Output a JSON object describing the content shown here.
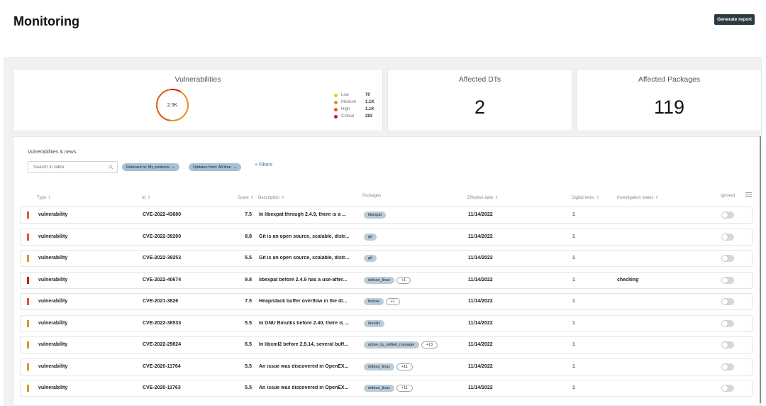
{
  "page": {
    "title": "Monitoring",
    "generate_report_label": "Generate report"
  },
  "cards": {
    "vulnerabilities": {
      "title": "Vulnerabilities",
      "total": "2.5K",
      "legend": [
        {
          "name": "Low",
          "value": "70",
          "color": "#f2c830"
        },
        {
          "name": "Medium",
          "value": "1.1K",
          "color": "#e8902a"
        },
        {
          "name": "High",
          "value": "1.1K",
          "color": "#e35b1e"
        },
        {
          "name": "Critical",
          "value": "283",
          "color": "#c81e1e"
        }
      ]
    },
    "affected_dts": {
      "title": "Affected DTs",
      "value": "2"
    },
    "affected_packages": {
      "title": "Affected Packages",
      "value": "119"
    }
  },
  "table": {
    "section_label": "Vulnerabilities & news",
    "search_placeholder": "Search in table",
    "filters": [
      {
        "label": "Relevant to: My products"
      },
      {
        "label": "Updates from: All time"
      }
    ],
    "add_filter_label": "+ Filters",
    "columns": {
      "type": "Type",
      "id": "Id",
      "score": "Score",
      "description": "Description",
      "packages": "Packages",
      "effective_date": "Effective date",
      "digital_twins": "Digital twins",
      "investigation_status": "Investigation status",
      "ignored": "Ignored"
    },
    "rows": [
      {
        "severity_color": "#e35b1e",
        "type": "vulnerability",
        "id": "CVE-2022-43680",
        "score": "7.5",
        "description": "In libexpat through 2.4.9, there is a ...",
        "packages": [
          "libexpat"
        ],
        "more": "",
        "date": "11/14/2022",
        "digital_twins": "1",
        "status": ""
      },
      {
        "severity_color": "#e35b1e",
        "type": "vulnerability",
        "id": "CVE-2022-39260",
        "score": "8.8",
        "description": "Git is an open source, scalable, distr...",
        "packages": [
          "git"
        ],
        "more": "",
        "date": "11/14/2022",
        "digital_twins": "1",
        "status": ""
      },
      {
        "severity_color": "#e8902a",
        "type": "vulnerability",
        "id": "CVE-2022-39253",
        "score": "5.5",
        "description": "Git is an open source, scalable, distr...",
        "packages": [
          "git"
        ],
        "more": "",
        "date": "11/14/2022",
        "digital_twins": "1",
        "status": ""
      },
      {
        "severity_color": "#c81e1e",
        "type": "vulnerability",
        "id": "CVE-2022-40674",
        "score": "9.8",
        "description": "libexpat before 2.4.9 has a use-after...",
        "packages": [
          "debian_linux"
        ],
        "more": "+1",
        "date": "11/14/2022",
        "digital_twins": "1",
        "status": "checking"
      },
      {
        "severity_color": "#e35b1e",
        "type": "vulnerability",
        "id": "CVE-2021-3826",
        "score": "7.5",
        "description": "Heap/stack buffer overflow in the dl...",
        "packages": [
          "fedora"
        ],
        "more": "+1",
        "date": "11/14/2022",
        "digital_twins": "1",
        "status": ""
      },
      {
        "severity_color": "#e8902a",
        "type": "vulnerability",
        "id": "CVE-2022-38533",
        "score": "5.5",
        "description": "In GNU Binutils before 2.40, there is ...",
        "packages": [
          "binutils"
        ],
        "more": "",
        "date": "11/14/2022",
        "digital_twins": "1",
        "status": ""
      },
      {
        "severity_color": "#e8902a",
        "type": "vulnerability",
        "id": "CVE-2022-29824",
        "score": "6.5",
        "description": "In libxml2 before 2.9.14, several buff...",
        "packages": [
          "active_iq_unified_manager"
        ],
        "more": "+13",
        "date": "11/14/2022",
        "digital_twins": "1",
        "status": ""
      },
      {
        "severity_color": "#e8902a",
        "type": "vulnerability",
        "id": "CVE-2020-11764",
        "score": "5.5",
        "description": "An issue was discovered in OpenEX...",
        "packages": [
          "debian_linux"
        ],
        "more": "+11",
        "date": "11/14/2022",
        "digital_twins": "1",
        "status": ""
      },
      {
        "severity_color": "#e8902a",
        "type": "vulnerability",
        "id": "CVE-2020-11763",
        "score": "5.5",
        "description": "An issue was discovered in OpenEX...",
        "packages": [
          "debian_linux"
        ],
        "more": "+11",
        "date": "11/14/2022",
        "digital_twins": "1",
        "status": ""
      }
    ]
  }
}
